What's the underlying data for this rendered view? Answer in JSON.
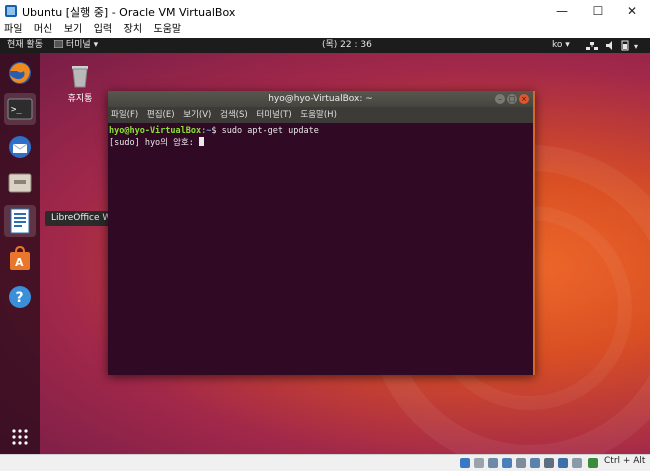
{
  "window": {
    "title": "Ubuntu [실행 중] - Oracle VM VirtualBox",
    "controls": {
      "minimize": "—",
      "maximize": "☐",
      "close": "✕"
    }
  },
  "host_menu": [
    "파일",
    "머신",
    "보기",
    "입력",
    "장치",
    "도움말"
  ],
  "guest_topbar": {
    "activities": "현재 활동",
    "app_menu": "터미널 ▾",
    "clock": "(목) 22 : 36",
    "input_lang": "ko ▾"
  },
  "desktop": {
    "trash_label": "휴지통"
  },
  "dock": {
    "tooltip": "LibreOffice Writer",
    "items": [
      "firefox-icon",
      "terminal-icon",
      "thunderbird-icon",
      "files-icon",
      "writer-icon",
      "software-icon",
      "help-icon",
      "apps-grid-icon"
    ]
  },
  "terminal": {
    "title": "hyo@hyo-VirtualBox: ~",
    "menu": [
      "파일(F)",
      "편집(E)",
      "보기(V)",
      "검색(S)",
      "터미널(T)",
      "도움말(H)"
    ],
    "prompt_user": "hyo@hyo-VirtualBox",
    "prompt_path": ":~",
    "prompt_symbol": "$",
    "command": " sudo apt-get update",
    "sudo_prompt": "[sudo] hyo의 암호: "
  },
  "statusbar": {
    "host_key": "Ctrl + Alt"
  },
  "colors": {
    "terminal_bg": "#300a24",
    "prompt_user": "#8ae234",
    "prompt_path": "#729fcf",
    "accent_orange": "#e95420"
  }
}
